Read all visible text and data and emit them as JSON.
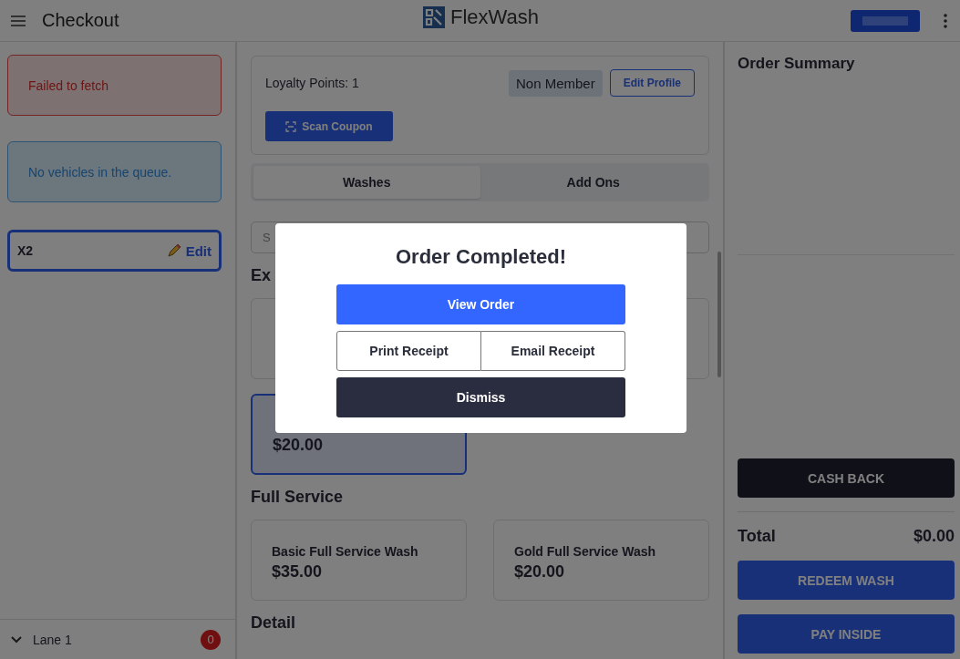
{
  "header": {
    "title": "Checkout",
    "brand": "FlexWash"
  },
  "sidebar": {
    "alerts": [
      {
        "kind": "error",
        "text": "Failed to fetch"
      },
      {
        "kind": "info",
        "text": "No vehicles in the queue."
      }
    ],
    "vehicle": {
      "label": "X2",
      "action": "Edit",
      "selected": true
    },
    "lane": {
      "label": "Lane 1",
      "count": "0"
    }
  },
  "customer": {
    "loyalty": "Loyalty Points: 1",
    "status": "Non Member",
    "edit_button": "Edit Profile",
    "scan_button": "Scan Coupon"
  },
  "tabs": [
    {
      "label": "Washes",
      "selected": true
    },
    {
      "label": "Add Ons",
      "selected": false
    }
  ],
  "search": {
    "placeholder": "S"
  },
  "sections": [
    {
      "title": "Ex",
      "items": [
        {
          "selected": false
        },
        {
          "selected": false
        },
        {
          "price": "$20.00",
          "selected": true
        }
      ]
    },
    {
      "title": "Full Service",
      "items": [
        {
          "name": "Basic Full Service Wash",
          "price": "$35.00",
          "selected": false
        },
        {
          "name": "Gold Full Service Wash",
          "price": "$20.00",
          "selected": false
        }
      ]
    },
    {
      "title": "Detail"
    }
  ],
  "summary": {
    "title": "Order Summary",
    "cash_back": "CASH BACK",
    "total_label": "Total",
    "total": "$0.00",
    "buttons": [
      "REDEEM WASH",
      "PAY INSIDE"
    ]
  },
  "modal": {
    "title": "Order Completed!",
    "primary": "View Order",
    "secondary": [
      "Print Receipt",
      "Email Receipt"
    ],
    "dismiss": "Dismiss"
  }
}
